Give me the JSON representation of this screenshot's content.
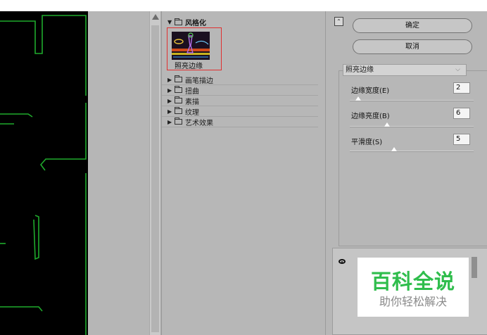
{
  "gallery": {
    "open_folder": "风格化",
    "selected_filter": "照亮边缘",
    "folders": [
      "画笔描边",
      "扭曲",
      "素描",
      "纹理",
      "艺术效果"
    ]
  },
  "buttons": {
    "ok": "确定",
    "cancel": "取消"
  },
  "filter_select": {
    "value": "照亮边缘"
  },
  "params": [
    {
      "label": "边缘宽度(E)",
      "value": "2",
      "level": 0.07
    },
    {
      "label": "边缘亮度(B)",
      "value": "6",
      "level": 0.3
    },
    {
      "label": "平滑度(S)",
      "value": "5",
      "level": 0.36
    }
  ],
  "watermark": {
    "title": "百科全说",
    "subtitle": "助你轻松解决"
  },
  "colors": {
    "edge_glow": "#1faa2c",
    "accent_red": "#e03030",
    "watermark_green": "#2fbd4c"
  },
  "icons": [
    "scroll-up-icon",
    "folder-icon",
    "collapse-icon",
    "eye-icon",
    "dropdown-caret-icon"
  ]
}
